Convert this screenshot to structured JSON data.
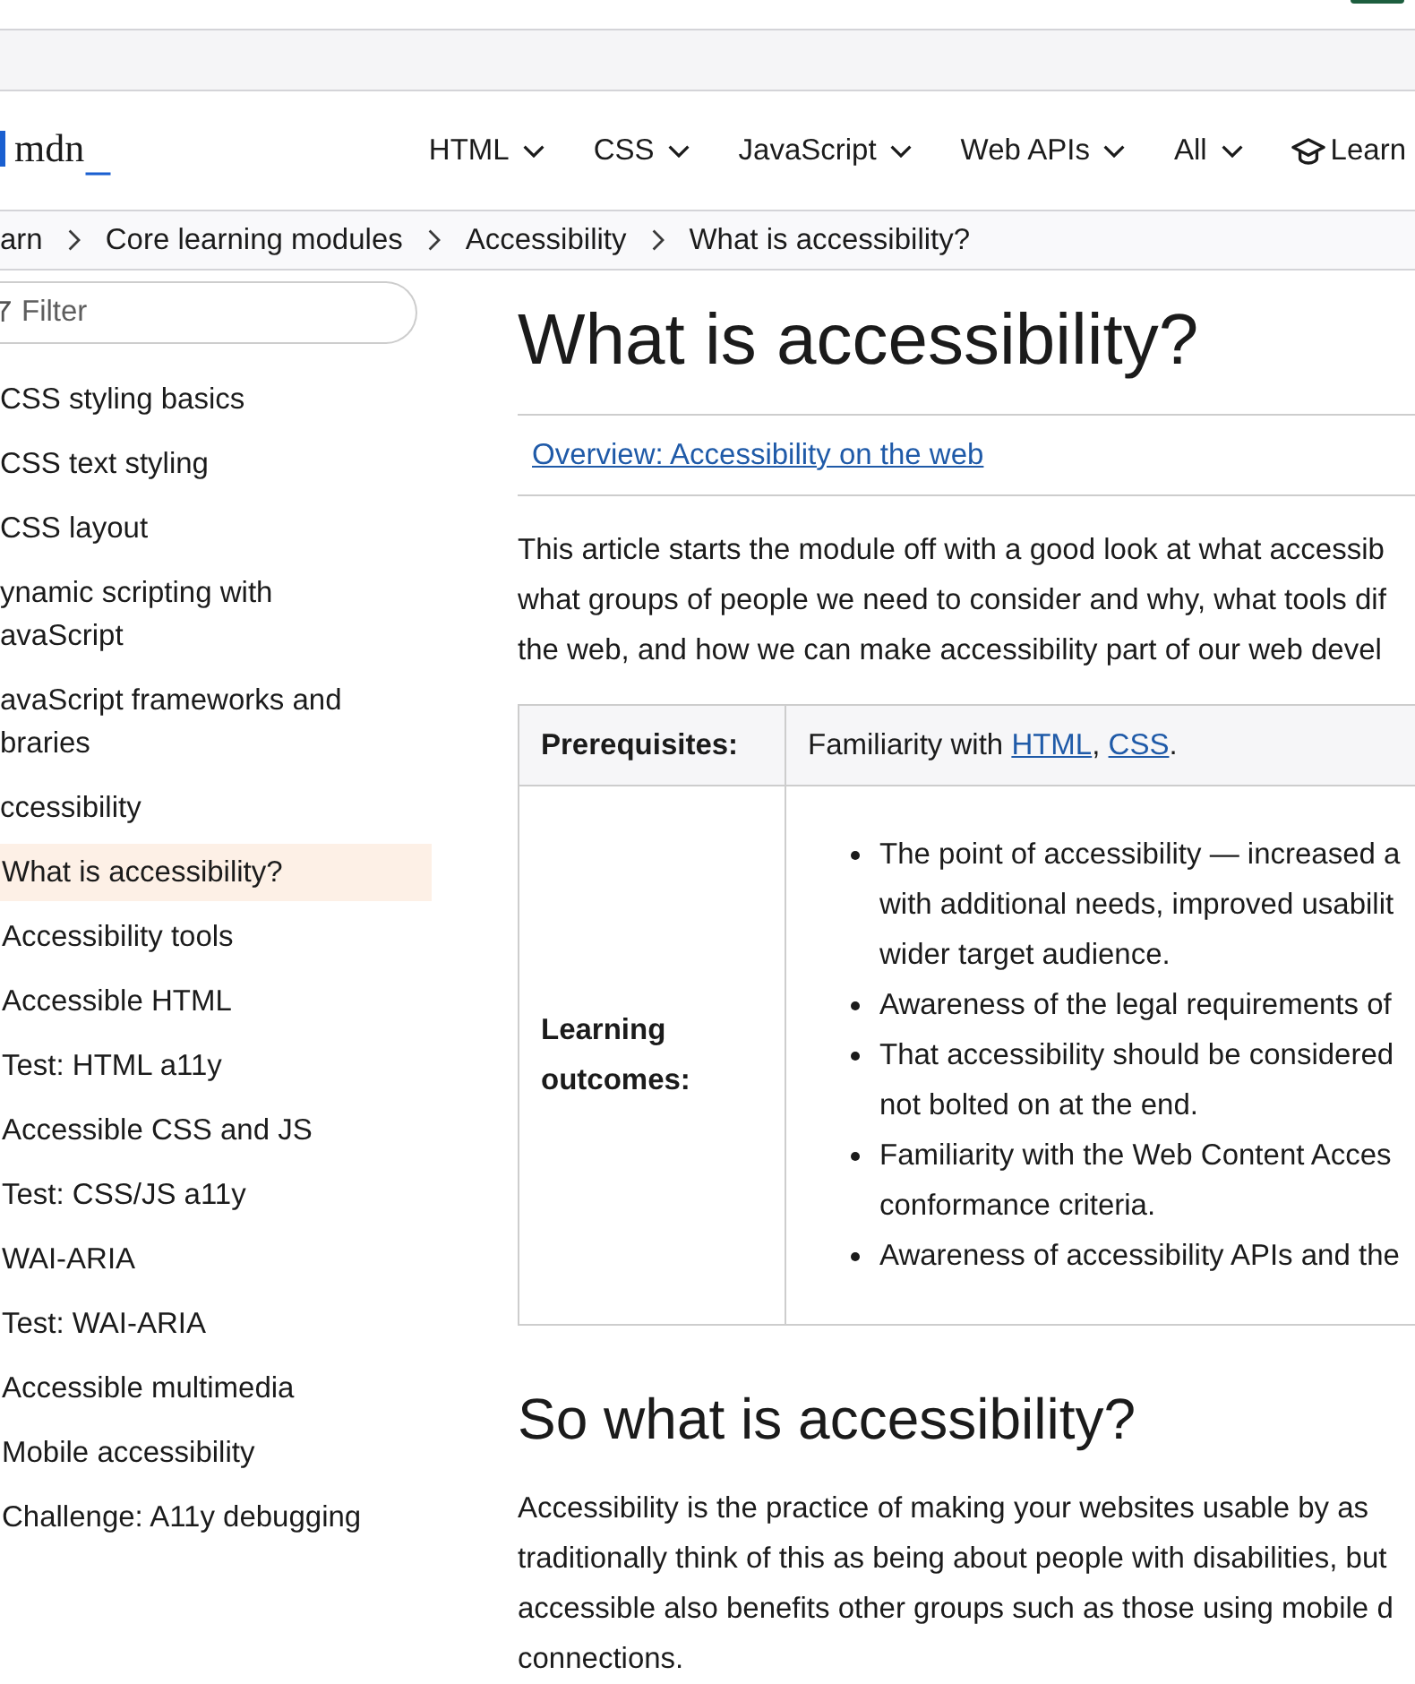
{
  "header": {
    "logo": {
      "wordmark": "mdn",
      "cursor": "_"
    },
    "nav": [
      {
        "label": "HTML",
        "kind": "menu"
      },
      {
        "label": "CSS",
        "kind": "menu"
      },
      {
        "label": "JavaScript",
        "kind": "menu"
      },
      {
        "label": "Web APIs",
        "kind": "menu"
      },
      {
        "label": "All",
        "kind": "menu"
      },
      {
        "label": "Learn",
        "kind": "learn"
      }
    ]
  },
  "breadcrumbs": [
    "arn",
    "Core learning modules",
    "Accessibility",
    "What is accessibility?"
  ],
  "sidebar": {
    "filter": {
      "placeholder": "Filter"
    },
    "items": [
      {
        "label": "CSS styling basics",
        "selected": false
      },
      {
        "label": "CSS text styling",
        "selected": false
      },
      {
        "label": "CSS layout",
        "selected": false
      },
      {
        "label": "ynamic scripting with avaScript",
        "selected": false
      },
      {
        "label": "avaScript frameworks and braries",
        "selected": false
      },
      {
        "label": "ccessibility",
        "selected": false,
        "children": [
          {
            "label": "What is accessibility?",
            "selected": true
          },
          {
            "label": "Accessibility tools",
            "selected": false
          },
          {
            "label": "Accessible HTML",
            "selected": false
          },
          {
            "label": "Test: HTML a11y",
            "selected": false
          },
          {
            "label": "Accessible CSS and JS",
            "selected": false
          },
          {
            "label": "Test: CSS/JS a11y",
            "selected": false
          },
          {
            "label": "WAI-ARIA",
            "selected": false
          },
          {
            "label": "Test: WAI-ARIA",
            "selected": false
          },
          {
            "label": "Accessible multimedia",
            "selected": false
          },
          {
            "label": "Mobile accessibility",
            "selected": false
          },
          {
            "label": "Challenge: A11y debugging",
            "selected": false
          }
        ]
      }
    ]
  },
  "article": {
    "title": "What is accessibility?",
    "overview_link": "Overview: Accessibility on the web",
    "intro_lines": [
      "This article starts the module off with a good look at what accessib",
      "what groups of people we need to consider and why, what tools dif",
      "the web, and how we can make accessibility part of our web devel"
    ],
    "table": {
      "rows": [
        {
          "header": "Prerequisites:",
          "kind": "text",
          "parts": [
            {
              "text": "Familiarity with ",
              "kind": "plain"
            },
            {
              "text": "HTML",
              "kind": "link"
            },
            {
              "text": ", ",
              "kind": "plain"
            },
            {
              "text": "CSS",
              "kind": "link"
            },
            {
              "text": ".",
              "kind": "plain"
            }
          ]
        },
        {
          "header": "Learning outcomes:",
          "kind": "list",
          "items": [
            {
              "lines": [
                "The point of accessibility — increased a",
                "with additional needs, improved usabilit",
                "wider target audience."
              ]
            },
            {
              "lines": [
                "Awareness of the legal requirements of"
              ]
            },
            {
              "lines": [
                "That accessibility should be considered",
                "not bolted on at the end."
              ]
            },
            {
              "lines": [
                "Familiarity with the Web Content Acces",
                "conformance criteria."
              ]
            },
            {
              "lines": [
                "Awareness of accessibility APIs and the"
              ]
            }
          ]
        }
      ]
    },
    "section": {
      "heading": "So what is accessibility?",
      "lines": [
        "Accessibility is the practice of making your websites usable by as",
        "traditionally think of this as being about people with disabilities, but",
        "accessible also benefits other groups such as those using mobile d",
        "connections."
      ]
    }
  }
}
